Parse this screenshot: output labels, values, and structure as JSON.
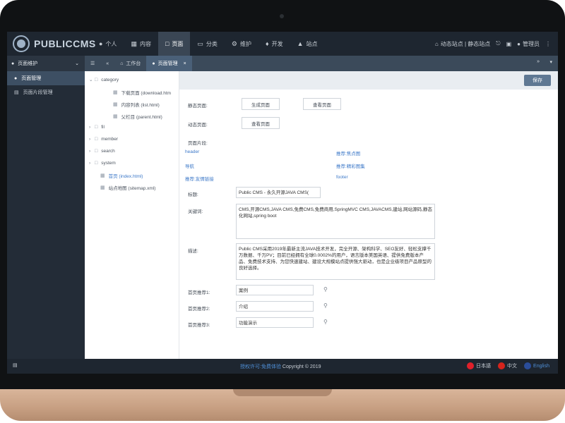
{
  "app": {
    "logo_text": "PUBLICCMS"
  },
  "nav": {
    "items": [
      {
        "icon": "user-icon",
        "label": "个人"
      },
      {
        "icon": "content-icon",
        "label": "内容"
      },
      {
        "icon": "page-icon",
        "label": "页面",
        "active": true
      },
      {
        "icon": "folder-icon",
        "label": "分类"
      },
      {
        "icon": "gears-icon",
        "label": "维护"
      },
      {
        "icon": "code-icon",
        "label": "开发"
      },
      {
        "icon": "sitemap-icon",
        "label": "站点"
      }
    ],
    "right": {
      "site_links": "动态站点 | 静态站点",
      "admin": "管理员"
    }
  },
  "sidebar": {
    "header": "页面维护",
    "items": [
      {
        "label": "页面管理",
        "active": true
      },
      {
        "label": "页面片段管理"
      }
    ]
  },
  "tabs": {
    "items": [
      {
        "label": "工作台"
      },
      {
        "label": "页面管理",
        "active": true
      }
    ]
  },
  "toolbar": {
    "save_label": "保存"
  },
  "tree": {
    "items": [
      {
        "label": "category"
      },
      {
        "label": "下载页面 (download.htm"
      },
      {
        "label": "内容列表 (list.html)"
      },
      {
        "label": "父栏目 (parent.html)"
      },
      {
        "label": "fil"
      },
      {
        "label": "member"
      },
      {
        "label": "search"
      },
      {
        "label": "system"
      },
      {
        "label": "首页 (index.html)"
      },
      {
        "label": "站点地图 (sitemap.xml)"
      }
    ]
  },
  "form": {
    "static_label": "静态页面:",
    "generate_btn": "生成页面",
    "view_btn": "查看页面",
    "dynamic_label": "动态页面:",
    "dynamic_view_btn": "查看页面",
    "fragment_label": "页面片段:",
    "fragments": [
      "header",
      "推荐:焦点图",
      "导航",
      "推荐:精彩图集",
      "推荐:友情链接",
      "footer"
    ],
    "title_label": "标题:",
    "title_value": "Public CMS - 永久开源JAVA CMS(",
    "keywords_label": "关键词:",
    "keywords_value": "CMS,开源CMS,JAVA CMS,免费CMS,免费商用,SpringMVC CMS,JAVACMS,建站,网站源码,静态化网站,spring boot",
    "desc_label": "描述:",
    "desc_value": "Public CMS采用2019年最新主流JAVA技术开发，完全开源、架构科学、SEO友好、轻松支撑千万数据、千万PV；目前已经拥有全球0.0002%的用户，语言版本美国英语、提供免费版本产品、免费技术支持、为您快速建站、建设大规模站点提供强大驱动，也是企业级项目产品原型的良好选择。",
    "rec1_label": "首页推荐1:",
    "rec1_value": "案例",
    "rec2_label": "首页推荐2:",
    "rec2_value": "介绍",
    "rec3_label": "首页推荐3:",
    "rec3_value": "功能演示"
  },
  "footer": {
    "license_link": "授权许可:免费体验",
    "copyright": "Copyright © 2019",
    "langs": [
      {
        "label": "日本語",
        "color": "#e0202a"
      },
      {
        "label": "中文",
        "color": "#d6241c"
      },
      {
        "label": "English",
        "color": "#2a4d9a"
      }
    ]
  }
}
